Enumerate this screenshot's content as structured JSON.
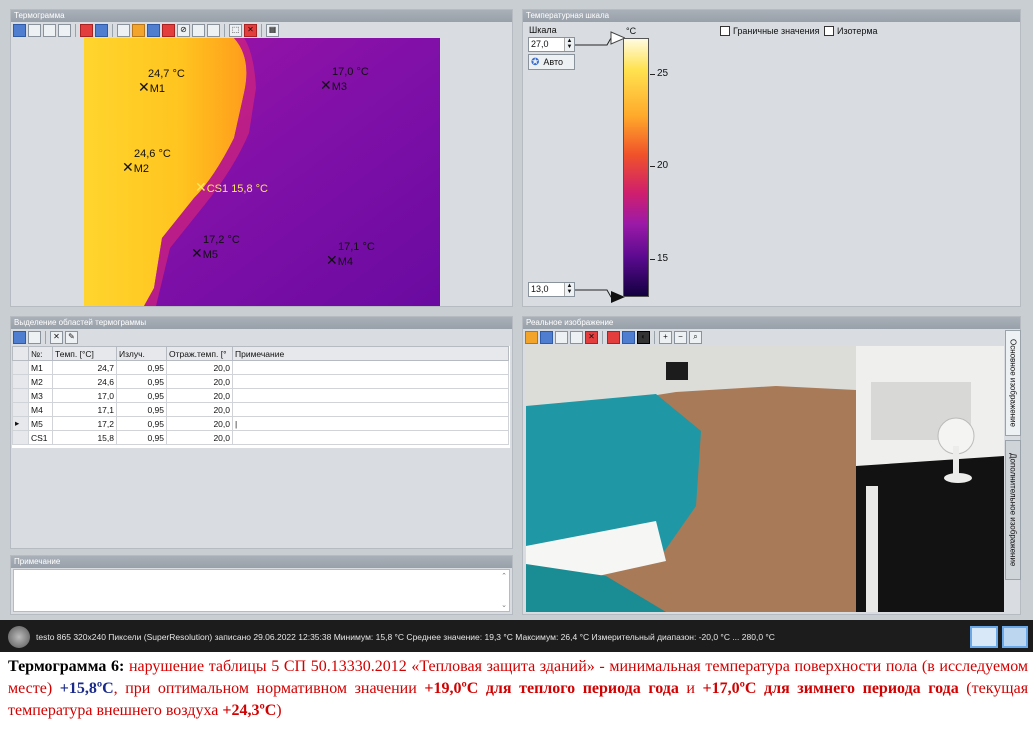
{
  "panels": {
    "thermogram_title": "Термограмма",
    "scale_title": "Температурная шкала",
    "regions_title": "Выделение областей термограммы",
    "note_title": "Примечание",
    "photo_title": "Реальное изображение"
  },
  "markers": [
    {
      "name": "M1",
      "temp": "24,7 °C"
    },
    {
      "name": "M2",
      "temp": "24,6 °C"
    },
    {
      "name": "M3",
      "temp": "17,0 °C"
    },
    {
      "name": "M4",
      "temp": "17,1 °C"
    },
    {
      "name": "M5",
      "temp": "17,2 °C"
    },
    {
      "name": "CS1",
      "temp": "CS1 15,8 °C"
    }
  ],
  "scale": {
    "label": "Шкала",
    "max_value": "27,0",
    "min_value": "13,0",
    "auto_button": "Авто",
    "unit": "°C",
    "ticks": [
      "25",
      "20",
      "15"
    ],
    "boundary_label": "Граничные значения",
    "isotherm_label": "Изотерма"
  },
  "table": {
    "headers": [
      "№:",
      "Темп. [°C]",
      "Излуч.",
      "Отраж.темп. [°",
      "Примечание"
    ],
    "rows": [
      {
        "id": "M1",
        "temp": "24,7",
        "emis": "0,95",
        "refl": "20,0"
      },
      {
        "id": "M2",
        "temp": "24,6",
        "emis": "0,95",
        "refl": "20,0"
      },
      {
        "id": "M3",
        "temp": "17,0",
        "emis": "0,95",
        "refl": "20,0"
      },
      {
        "id": "M4",
        "temp": "17,1",
        "emis": "0,95",
        "refl": "20,0"
      },
      {
        "id": "M5",
        "temp": "17,2",
        "emis": "0,95",
        "refl": "20,0"
      },
      {
        "id": "CS1",
        "temp": "15,8",
        "emis": "0,95",
        "refl": "20,0"
      }
    ]
  },
  "photo_tabs": {
    "main": "Основное изображение",
    "extra": "Дополнительное изображение"
  },
  "status_text": "testo 865 320x240 Пиксели (SuperResolution) записано 29.06.2022 12:35:38 Минимум: 15,8 °C Среднее значение: 19,3 °C Максимум: 26,4 °C Измерительный диапазон: -20,0 °C ... 280,0 °C",
  "caption": {
    "title": "Термограмма 6:",
    "part1": "нарушение таблицы 5 СП 50.13330.2012 «Тепловая защита зданий» - минимальная температура поверхности пола (в исследуемом месте)",
    "value_measured": "+15,8ºС",
    "part2": ", при оптимальном нормативном значении",
    "value_warm": "+19,0ºС для теплого периода года",
    "part3": "и",
    "value_winter": "+17,0ºС для зимнего периода года",
    "part4": "(текущая температура внешнего воздуха",
    "value_outside": "+24,3ºС",
    "part5": ")"
  }
}
